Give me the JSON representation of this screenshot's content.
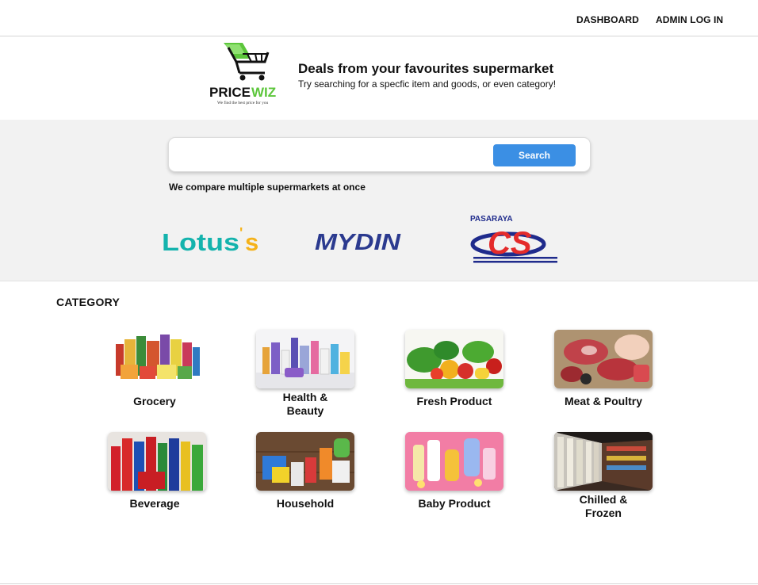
{
  "nav": {
    "dashboard": "DASHBOARD",
    "admin_login": "ADMIN LOG IN"
  },
  "brand": {
    "logo_text_price": "PRICE",
    "logo_text_wiz": "WIZ",
    "logo_tagline": "We find the best price for you",
    "headline": "Deals from your favourites supermarket",
    "subline": "Try searching for a specfic item and goods, or even category!"
  },
  "search": {
    "value": "",
    "placeholder": "",
    "button_label": "Search"
  },
  "compare_text": "We compare multiple supermarkets at once",
  "supermarkets": [
    {
      "name": "Lotus's",
      "color": "#14b3ad",
      "accent": "#f5b21a"
    },
    {
      "name": "MYDIN",
      "color": "#2b3a8f"
    },
    {
      "name": "CS",
      "prefix": "PASARAYA",
      "color": "#1f2b8c",
      "accent": "#e42b2b"
    }
  ],
  "category": {
    "title": "CATEGORY",
    "items": [
      {
        "label": "Grocery",
        "icon": "grocery-products-image"
      },
      {
        "label": "Health & Beauty",
        "icon": "health-beauty-products-image"
      },
      {
        "label": "Fresh Product",
        "icon": "fresh-vegetables-image"
      },
      {
        "label": "Meat & Poultry",
        "icon": "raw-meat-image"
      },
      {
        "label": "Beverage",
        "icon": "soft-drink-bottles-image"
      },
      {
        "label": "Household",
        "icon": "cleaning-supplies-image"
      },
      {
        "label": "Baby Product",
        "icon": "baby-care-products-image"
      },
      {
        "label": "Chilled & Frozen",
        "icon": "freezer-aisle-image"
      }
    ]
  },
  "colors": {
    "primary_button": "#3b8fe4",
    "band_background": "#f2f2f2",
    "logo_green": "#5cc63b"
  }
}
